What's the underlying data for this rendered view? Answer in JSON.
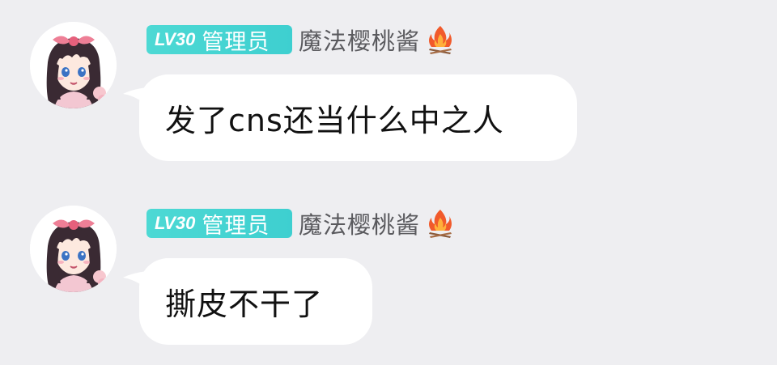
{
  "messages": [
    {
      "level_prefix": "LV",
      "level_number": "30",
      "role": "管理员",
      "nickname": "魔法樱桃酱",
      "text": "发了cns还当什么中之人",
      "avatar_icon": "anime-girl-avatar",
      "badge_icon": "campfire-icon"
    },
    {
      "level_prefix": "LV",
      "level_number": "30",
      "role": "管理员",
      "nickname": "魔法樱桃酱",
      "text": "撕皮不干了",
      "avatar_icon": "anime-girl-avatar",
      "badge_icon": "campfire-icon"
    }
  ],
  "colors": {
    "background": "#eeeef1",
    "badge": "#3ecfd0",
    "bubble": "#ffffff",
    "nickname": "#5a5a5e"
  }
}
